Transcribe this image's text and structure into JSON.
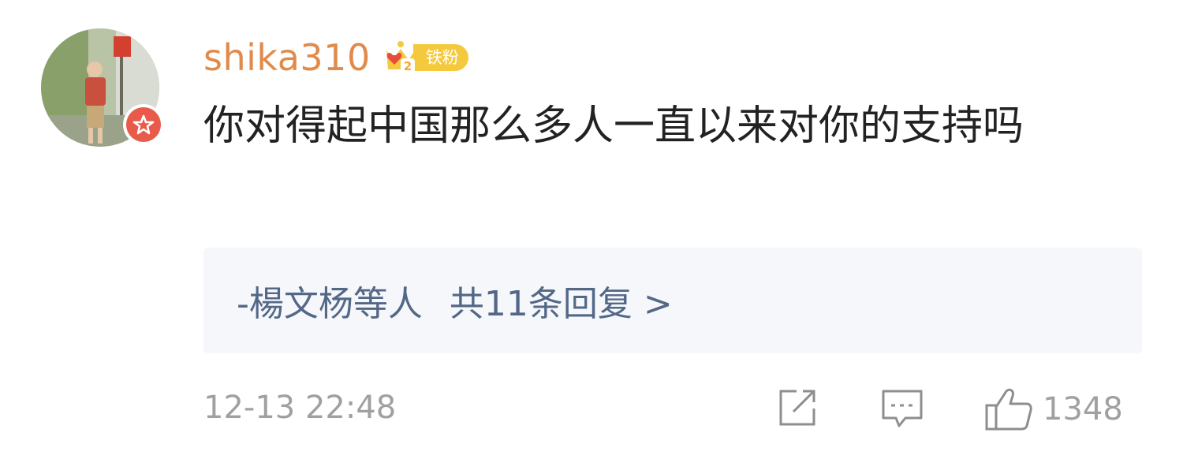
{
  "comment": {
    "username": "shika310",
    "fan_badge": {
      "level": "2",
      "label": "铁粉",
      "color": "#f5c93e"
    },
    "text": "你对得起中国那么多人一直以来对你的支持吗",
    "replies": {
      "names": "-楊文杨等人",
      "count_text": "共11条回复 >"
    },
    "timestamp": "12-13 22:48",
    "likes": "1348"
  },
  "colors": {
    "username": "#e08b4c",
    "reply_link": "#536887",
    "meta": "#a0a0a0",
    "verify_badge": "#e85a4a"
  },
  "icons": [
    "share-icon",
    "comment-icon",
    "like-icon",
    "verified-icon",
    "crown-icon"
  ]
}
